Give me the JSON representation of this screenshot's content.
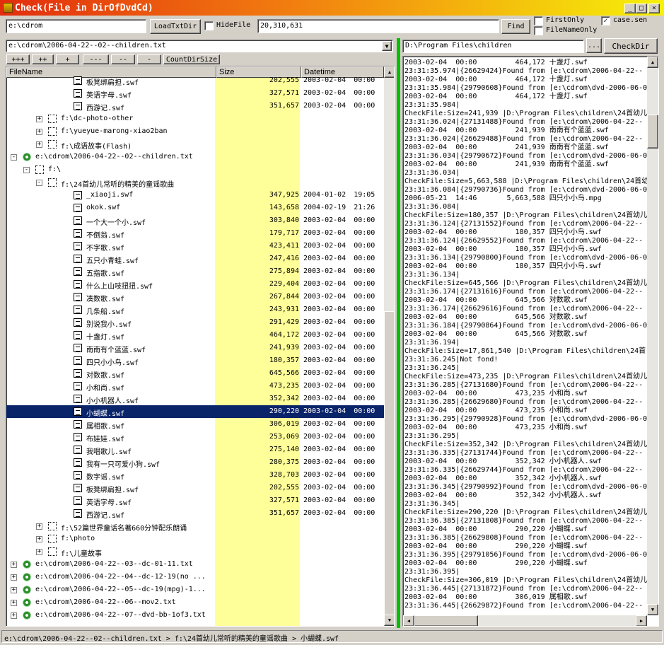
{
  "app": {
    "title": "Check(File in DirOfDvdCd)",
    "window_buttons": [
      "_",
      "□",
      "×"
    ]
  },
  "toolbar": {
    "path_value": "e:\\cdrom",
    "load_button": "LoadTxtDir",
    "hidefile_label": "HideFile",
    "hidefile_checked": false,
    "search_value": "20,310,631",
    "find_button": "Find",
    "firstonly_label": "FirstOnly",
    "firstonly_checked": false,
    "filenameonly_label": "FileNameOnly",
    "filenameonly_checked": false,
    "casesen_label": "case.sen",
    "casesen_checked": true
  },
  "left": {
    "file_combo": "e:\\cdrom\\2006-04-22--02--children.txt",
    "expand_buttons": [
      "+++",
      "++",
      "+",
      "---",
      "--",
      "-"
    ],
    "count_button": "CountDirSize",
    "columns": [
      "FileName",
      "Size",
      "Datetime"
    ],
    "rows": [
      {
        "indent": 4,
        "type": "file",
        "name": "板凳绑扁担.swf",
        "size": "202,555",
        "date": "2003-02-04",
        "time": "00:00"
      },
      {
        "indent": 4,
        "type": "file",
        "name": "英语字母.swf",
        "size": "327,571",
        "date": "2003-02-04",
        "time": "00:00"
      },
      {
        "indent": 4,
        "type": "file",
        "name": "西游记.swf",
        "size": "351,657",
        "date": "2003-02-04",
        "time": "00:00"
      },
      {
        "indent": 2,
        "type": "folder",
        "pm": "+",
        "name": "f:\\dc-photo-other",
        "size": "",
        "date": "",
        "time": ""
      },
      {
        "indent": 2,
        "type": "folder",
        "pm": "+",
        "name": "f:\\yueyue-marong-xiao2ban",
        "size": "",
        "date": "",
        "time": ""
      },
      {
        "indent": 2,
        "type": "folder",
        "pm": "+",
        "name": "f:\\成语故事(Flash)",
        "size": "",
        "date": "",
        "time": ""
      },
      {
        "indent": 0,
        "type": "cd",
        "pm": "-",
        "name": "e:\\cdrom\\2006-04-22--02--children.txt",
        "size": "",
        "date": "",
        "time": ""
      },
      {
        "indent": 1,
        "type": "folder",
        "pm": "-",
        "name": "f:\\",
        "size": "",
        "date": "",
        "time": ""
      },
      {
        "indent": 2,
        "type": "folder",
        "pm": "-",
        "name": "f:\\24首幼儿常听的精美的童谣歌曲",
        "size": "",
        "date": "",
        "time": ""
      },
      {
        "indent": 4,
        "type": "file",
        "name": "_xiaoji.swf",
        "size": "347,925",
        "date": "2004-01-02",
        "time": "19:05"
      },
      {
        "indent": 4,
        "type": "file",
        "name": "okok.swf",
        "size": "143,658",
        "date": "2004-02-19",
        "time": "21:26"
      },
      {
        "indent": 4,
        "type": "file",
        "name": "一个大一个小.swf",
        "size": "303,840",
        "date": "2003-02-04",
        "time": "00:00"
      },
      {
        "indent": 4,
        "type": "file",
        "name": "不倒翁.swf",
        "size": "179,717",
        "date": "2003-02-04",
        "time": "00:00"
      },
      {
        "indent": 4,
        "type": "file",
        "name": "不字歌.swf",
        "size": "423,411",
        "date": "2003-02-04",
        "time": "00:00"
      },
      {
        "indent": 4,
        "type": "file",
        "name": "五只小青蛙.swf",
        "size": "247,416",
        "date": "2003-02-04",
        "time": "00:00"
      },
      {
        "indent": 4,
        "type": "file",
        "name": "五指歌.swf",
        "size": "275,894",
        "date": "2003-02-04",
        "time": "00:00"
      },
      {
        "indent": 4,
        "type": "file",
        "name": "什么上山吱扭扭.swf",
        "size": "229,404",
        "date": "2003-02-04",
        "time": "00:00"
      },
      {
        "indent": 4,
        "type": "file",
        "name": "凑数歌.swf",
        "size": "267,844",
        "date": "2003-02-04",
        "time": "00:00"
      },
      {
        "indent": 4,
        "type": "file",
        "name": "几条船.swf",
        "size": "243,931",
        "date": "2003-02-04",
        "time": "00:00"
      },
      {
        "indent": 4,
        "type": "file",
        "name": "别说我小.swf",
        "size": "291,429",
        "date": "2003-02-04",
        "time": "00:00"
      },
      {
        "indent": 4,
        "type": "file",
        "name": "十盏灯.swf",
        "size": "464,172",
        "date": "2003-02-04",
        "time": "00:00"
      },
      {
        "indent": 4,
        "type": "file",
        "name": "南南有个蓝蓝.swf",
        "size": "241,939",
        "date": "2003-02-04",
        "time": "00:00"
      },
      {
        "indent": 4,
        "type": "file",
        "name": "四只小小鸟.swf",
        "size": "180,357",
        "date": "2003-02-04",
        "time": "00:00"
      },
      {
        "indent": 4,
        "type": "file",
        "name": "对数歌.swf",
        "size": "645,566",
        "date": "2003-02-04",
        "time": "00:00"
      },
      {
        "indent": 4,
        "type": "file",
        "name": "小和尚.swf",
        "size": "473,235",
        "date": "2003-02-04",
        "time": "00:00"
      },
      {
        "indent": 4,
        "type": "file",
        "name": "小小机器人.swf",
        "size": "352,342",
        "date": "2003-02-04",
        "time": "00:00"
      },
      {
        "indent": 4,
        "type": "file",
        "name": "小蝴蝶.swf",
        "size": "290,220",
        "date": "2003-02-04",
        "time": "00:00",
        "selected": true
      },
      {
        "indent": 4,
        "type": "file",
        "name": "属相歌.swf",
        "size": "306,019",
        "date": "2003-02-04",
        "time": "00:00"
      },
      {
        "indent": 4,
        "type": "file",
        "name": "布娃娃.swf",
        "size": "253,069",
        "date": "2003-02-04",
        "time": "00:00"
      },
      {
        "indent": 4,
        "type": "file",
        "name": "我唱歌儿.swf",
        "size": "275,140",
        "date": "2003-02-04",
        "time": "00:00"
      },
      {
        "indent": 4,
        "type": "file",
        "name": "我有一只可爱小狗.swf",
        "size": "280,375",
        "date": "2003-02-04",
        "time": "00:00"
      },
      {
        "indent": 4,
        "type": "file",
        "name": "数字谣.swf",
        "size": "328,703",
        "date": "2003-02-04",
        "time": "00:00"
      },
      {
        "indent": 4,
        "type": "file",
        "name": "板凳绑扁担.swf",
        "size": "202,555",
        "date": "2003-02-04",
        "time": "00:00"
      },
      {
        "indent": 4,
        "type": "file",
        "name": "英语字母.swf",
        "size": "327,571",
        "date": "2003-02-04",
        "time": "00:00"
      },
      {
        "indent": 4,
        "type": "file",
        "name": "西游记.swf",
        "size": "351,657",
        "date": "2003-02-04",
        "time": "00:00"
      },
      {
        "indent": 2,
        "type": "folder",
        "pm": "+",
        "name": "f:\\52篇世界童话名著660分钟配乐朗诵",
        "size": "",
        "date": "",
        "time": ""
      },
      {
        "indent": 2,
        "type": "folder",
        "pm": "+",
        "name": "f:\\photo",
        "size": "",
        "date": "",
        "time": ""
      },
      {
        "indent": 2,
        "type": "folder",
        "pm": "+",
        "name": "f:\\儿童故事",
        "size": "",
        "date": "",
        "time": ""
      },
      {
        "indent": 0,
        "type": "cd",
        "pm": "+",
        "name": "e:\\cdrom\\2006-04-22--03--dc-01-11.txt",
        "size": "",
        "date": "",
        "time": ""
      },
      {
        "indent": 0,
        "type": "cd",
        "pm": "+",
        "name": "e:\\cdrom\\2006-04-22--04--dc-12-19(no ...",
        "size": "",
        "date": "",
        "time": ""
      },
      {
        "indent": 0,
        "type": "cd",
        "pm": "+",
        "name": "e:\\cdrom\\2006-04-22--05--dc-19(mpg)-1...",
        "size": "",
        "date": "",
        "time": ""
      },
      {
        "indent": 0,
        "type": "cd",
        "pm": "+",
        "name": "e:\\cdrom\\2006-04-22--06--mov2.txt",
        "size": "",
        "date": "",
        "time": ""
      },
      {
        "indent": 0,
        "type": "cd",
        "pm": "+",
        "name": "e:\\cdrom\\2006-04-22--07--dvd-bb-1of3.txt",
        "size": "",
        "date": "",
        "time": ""
      }
    ]
  },
  "right": {
    "dir_value": "D:\\Program Files\\children",
    "browse_button": "...",
    "checkdir_button": "CheckDir",
    "log": [
      "2003-02-04  00:00         464,172 十盏灯.swf",
      "23:31:35.974|{26629424}Found from [e:\\cdrom\\2006-04-22--",
      "2003-02-04  00:00         464,172 十盏灯.swf",
      "23:31:35.984|{29790608}Found from [e:\\cdrom\\dvd-2006-06-0",
      "2003-02-04  00:00         464,172 十盏灯.swf",
      "23:31:35.984|",
      "CheckFile:Size=241,939 |D:\\Program Files\\children\\24首幼儿",
      "23:31:36.024|{27131488}Found from [e:\\cdrom\\2006-04-22--",
      "2003-02-04  00:00         241,939 南南有个蓝蓝.swf",
      "23:31:36.024|{26629488}Found from [e:\\cdrom\\2006-04-22--",
      "2003-02-04  00:00         241,939 南南有个蓝蓝.swf",
      "23:31:36.034|{29790672}Found from [e:\\cdrom\\dvd-2006-06-0",
      "2003-02-04  00:00         241,939 南南有个蓝蓝.swf",
      "23:31:36.034|",
      "CheckFile:Size=5,663,588 |D:\\Program Files\\children\\24首幼",
      "23:31:36.084|{29790736}Found from [e:\\cdrom\\dvd-2006-06-0",
      "2006-05-21  14:46       5,663,588 四只小小鸟.mpg",
      "23:31:36.084|",
      "CheckFile:Size=180,357 |D:\\Program Files\\children\\24首幼儿",
      "23:31:36.124|{27131552}Found from [e:\\cdrom\\2006-04-22--",
      "2003-02-04  00:00         180,357 四只小小鸟.swf",
      "23:31:36.124|{26629552}Found from [e:\\cdrom\\2006-04-22--",
      "2003-02-04  00:00         180,357 四只小小鸟.swf",
      "23:31:36.134|{29790800}Found from [e:\\cdrom\\dvd-2006-06-0",
      "2003-02-04  00:00         180,357 四只小小鸟.swf",
      "23:31:36.134|",
      "CheckFile:Size=645,566 |D:\\Program Files\\children\\24首幼儿",
      "23:31:36.174|{27131616}Found from [e:\\cdrom\\2006-04-22--",
      "2003-02-04  00:00         645,566 对数歌.swf",
      "23:31:36.174|{26629616}Found from [e:\\cdrom\\2006-04-22--",
      "2003-02-04  00:00         645,566 对数歌.swf",
      "23:31:36.184|{29790864}Found from [e:\\cdrom\\dvd-2006-06-0",
      "2003-02-04  00:00         645,566 对数歌.swf",
      "23:31:36.194|",
      "CheckFile:Size=17,861,540 |D:\\Program Files\\children\\24首",
      "23:31:36.245|Not fond!",
      "23:31:36.245|",
      "CheckFile:Size=473,235 |D:\\Program Files\\children\\24首幼儿",
      "23:31:36.285|{27131680}Found from [e:\\cdrom\\2006-04-22--",
      "2003-02-04  00:00         473,235 小和尚.swf",
      "23:31:36.285|{26629680}Found from [e:\\cdrom\\2006-04-22--",
      "2003-02-04  00:00         473,235 小和尚.swf",
      "23:31:36.295|{29790928}Found from [e:\\cdrom\\dvd-2006-06-0",
      "2003-02-04  00:00         473,235 小和尚.swf",
      "23:31:36.295|",
      "CheckFile:Size=352,342 |D:\\Program Files\\children\\24首幼儿",
      "23:31:36.335|{27131744}Found from [e:\\cdrom\\2006-04-22--",
      "2003-02-04  00:00         352,342 小小机器人.swf",
      "23:31:36.335|{26629744}Found from [e:\\cdrom\\2006-04-22--",
      "2003-02-04  00:00         352,342 小小机器人.swf",
      "23:31:36.345|{29790992}Found from [e:\\cdrom\\dvd-2006-06-0",
      "2003-02-04  00:00         352,342 小小机器人.swf",
      "23:31:36.345|",
      "CheckFile:Size=290,220 |D:\\Program Files\\children\\24首幼儿",
      "23:31:36.385|{27131808}Found from [e:\\cdrom\\2006-04-22--",
      "2003-02-04  00:00         290,220 小蝴蝶.swf",
      "23:31:36.385|{26629808}Found from [e:\\cdrom\\2006-04-22--",
      "2003-02-04  00:00         290,220 小蝴蝶.swf",
      "23:31:36.395|{29791056}Found from [e:\\cdrom\\dvd-2006-06-0",
      "2003-02-04  00:00         290,220 小蝴蝶.swf",
      "23:31:36.395|",
      "CheckFile:Size=306,019 |D:\\Program Files\\children\\24首幼儿",
      "23:31:36.445|{27131872}Found from [e:\\cdrom\\2006-04-22--",
      "2003-02-04  00:00         306,019 属相歌.swf",
      "23:31:36.445|{26629872}Found from [e:\\cdrom\\2006-04-22--"
    ]
  },
  "status": {
    "path": "e:\\cdrom\\2006-04-22--02--children.txt > f:\\24首幼儿常听的精美的童谣歌曲 > 小蝴蝶.swf"
  },
  "colors": {
    "size_column": "#ffff99",
    "selected_row": "#0a246a",
    "splitter": "#00c000"
  }
}
